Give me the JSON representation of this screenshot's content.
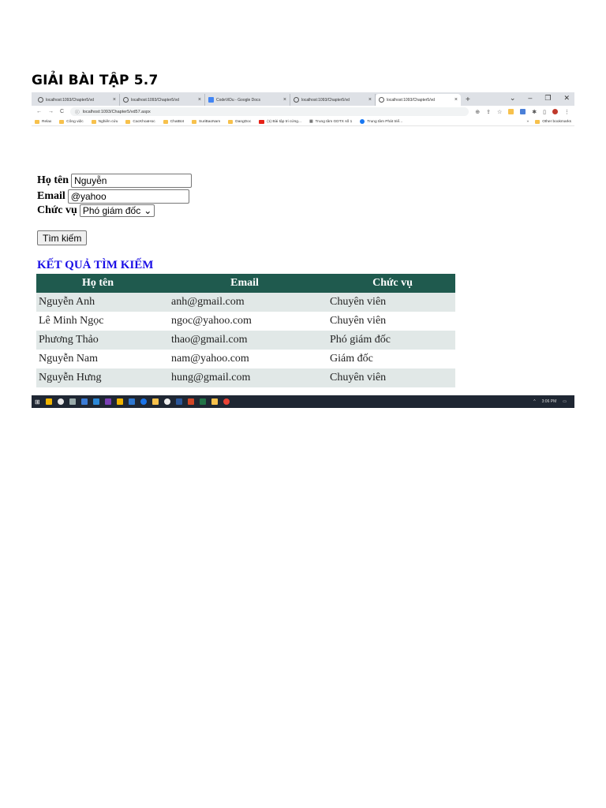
{
  "document": {
    "title": "GIẢI BÀI TẬP 5.7"
  },
  "browser": {
    "tabs": [
      {
        "label": "localhost:1093/Chapter5/vd",
        "active": false
      },
      {
        "label": "localhost:1093/Chapter5/vd",
        "active": false
      },
      {
        "label": "CodeViDu - Google Docs",
        "active": false
      },
      {
        "label": "localhost:1093/Chapter5/vd",
        "active": false
      },
      {
        "label": "localhost:1093/Chapter5/vd",
        "active": true
      }
    ],
    "new_tab": "+",
    "url": "localhost:1093/Chapter5/vd57.aspx",
    "bookmarks": [
      "Relax",
      "Công việc",
      "Nghiên cứu",
      "CacKhoaHoc",
      "ChatBot",
      "SuriBaoNam",
      "DangDoc",
      "(1) Bài tập tri cứng...",
      "Trung tâm GDTX số 1",
      "Trung tâm Phát triể..."
    ],
    "bookmarks_more": "»",
    "other_bookmarks": "Other bookmarks"
  },
  "form": {
    "name_label": "Họ tên",
    "name_value": "Nguyễn",
    "email_label": "Email",
    "email_value": "@yahoo",
    "position_label": "Chức vụ",
    "position_value": "Phó giám đốc",
    "search_button": "Tìm kiếm"
  },
  "results": {
    "title": "KẾT QUẢ TÌM KIẾM",
    "headers": [
      "Họ tên",
      "Email",
      "Chức vụ"
    ],
    "rows": [
      [
        "Nguyễn Anh",
        "anh@gmail.com",
        "Chuyên viên"
      ],
      [
        "Lê Minh Ngọc",
        "ngoc@yahoo.com",
        "Chuyên viên"
      ],
      [
        "Phương Thảo",
        "thao@gmail.com",
        "Phó giám đốc"
      ],
      [
        "Nguyễn Nam",
        "nam@yahoo.com",
        "Giám đốc"
      ],
      [
        "Nguyễn Hưng",
        "hung@gmail.com",
        "Chuyên viên"
      ]
    ]
  },
  "taskbar": {
    "clock": "3:06 PM"
  },
  "colors": {
    "table_header": "#1f5a4e",
    "row_alt": "#e1e8e7",
    "result_title": "#1a0ee6",
    "taskbar": "#1f2733"
  }
}
